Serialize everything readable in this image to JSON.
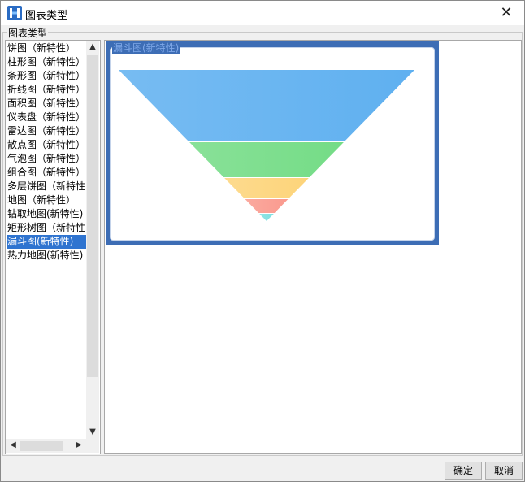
{
  "window": {
    "title": "图表类型",
    "close_label": "✕"
  },
  "group_label": "图表类型",
  "chart_types": [
    "饼图（新特性）",
    "柱形图（新特性）",
    "条形图（新特性）",
    "折线图（新特性）",
    "面积图（新特性）",
    "仪表盘（新特性）",
    "雷达图（新特性）",
    "散点图（新特性）",
    "气泡图（新特性）",
    "组合图（新特性）",
    "多层饼图（新特性",
    "地图（新特性）",
    "钻取地图(新特性)",
    "矩形树图（新特性",
    "漏斗图(新特性)",
    "热力地图(新特性)"
  ],
  "selected_index": 14,
  "preview": {
    "legend": "漏斗图(新特性)"
  },
  "funnel": {
    "colors": [
      "#5fb0f0",
      "#74dc86",
      "#fdd47a",
      "#fa9a8e",
      "#7fe0e0"
    ]
  },
  "scroll_icons": {
    "up": "▲",
    "down": "▼",
    "left": "◀",
    "right": "▶"
  },
  "buttons": {
    "ok": "确定",
    "cancel": "取消"
  }
}
